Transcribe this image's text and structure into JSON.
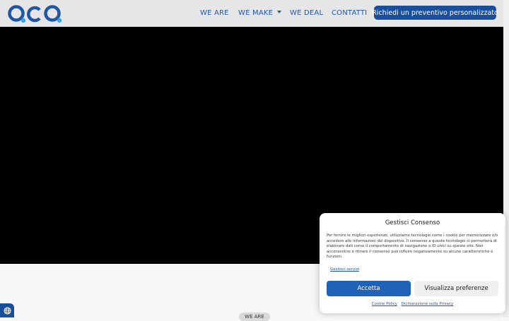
{
  "brand": {
    "logo_text": "QCQ",
    "colors": {
      "primary": "#1a4f9c",
      "accent": "#35a8e0",
      "header_bg": "#e6e6e6",
      "hero_bg": "#000000"
    }
  },
  "nav": {
    "items": [
      {
        "label": "WE ARE"
      },
      {
        "label": "WE MAKE",
        "has_dropdown": true
      },
      {
        "label": "WE DEAL"
      },
      {
        "label": "CONTATTI"
      }
    ],
    "cta_label": "Richiedi un preventivo personalizzato"
  },
  "section": {
    "pill_label": "WE ARE"
  },
  "consent": {
    "title": "Gestisci Consenso",
    "body": "Per fornire le migliori esperienze, utilizziamo tecnologie come i cookie per memorizzare e/o accedere alle informazioni del dispositivo. Il consenso a queste tecnologie ci permetterà di elaborare dati come il comportamento di navigazione o ID unici su questo sito. Non acconsentire o ritirare il consenso può influire negativamente su alcune caratteristiche e funzioni.",
    "manage_services_label": "Gestisci servizi",
    "accept_label": "Accetta",
    "preferences_label": "Visualizza preferenze",
    "cookie_policy_label": "Cookie Policy",
    "privacy_label": "Dichiarazione sulla Privacy"
  },
  "icons": {
    "language": "globe-icon",
    "dropdown": "caret-down-icon"
  }
}
